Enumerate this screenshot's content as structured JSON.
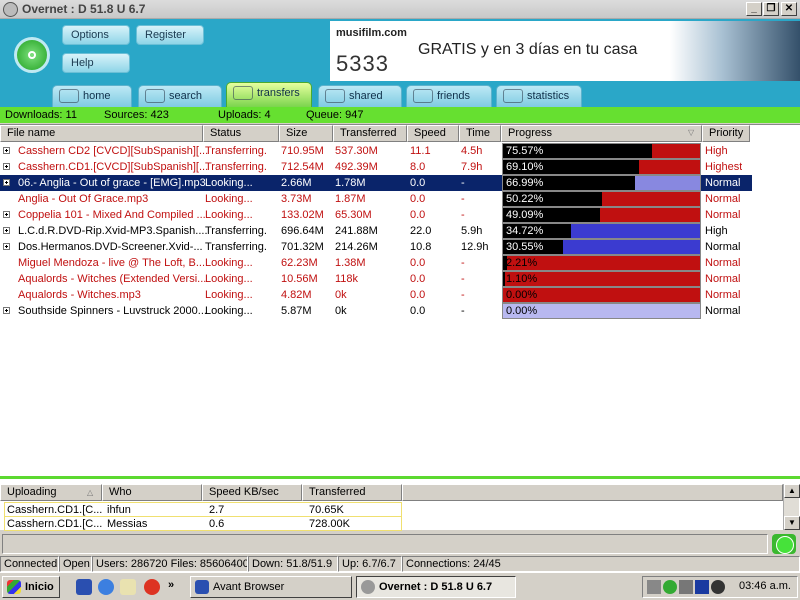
{
  "window": {
    "title": "Overnet : D 51.8 U 6.7"
  },
  "header": {
    "buttons": {
      "options": "Options",
      "register": "Register",
      "help": "Help"
    },
    "banner": {
      "brand": "musifilm.com",
      "number": "5333",
      "promo": "GRATIS y en 3 días en tu casa"
    },
    "tabs": [
      "home",
      "search",
      "transfers",
      "shared",
      "friends",
      "statistics"
    ],
    "active_tab": "transfers"
  },
  "summary": {
    "downloads": "Downloads: 11",
    "sources": "Sources: 423",
    "uploads": "Uploads: 4",
    "queue": "Queue: 947"
  },
  "columns": [
    "File name",
    "Status",
    "Size",
    "Transferred",
    "Speed",
    "Time",
    "Progress",
    "Priority"
  ],
  "rows": [
    {
      "name": "Casshern CD2 [CVCD][SubSpanish][...",
      "status": "Transferring.",
      "size": "710.95M",
      "transferred": "537.30M",
      "speed": "11.1",
      "time": "4.5h",
      "progress": "75.57%",
      "priority": "High",
      "expandable": true,
      "color": "red"
    },
    {
      "name": "Casshern.CD1.[CVCD][SubSpanish][...",
      "status": "Transferring.",
      "size": "712.54M",
      "transferred": "492.39M",
      "speed": "8.0",
      "time": "7.9h",
      "progress": "69.10%",
      "priority": "Highest",
      "expandable": true,
      "color": "red"
    },
    {
      "name": "06.- Anglia - Out of grace - [EMG].mp3",
      "status": "Looking...",
      "size": "2.66M",
      "transferred": "1.78M",
      "speed": "0.0",
      "time": "-",
      "progress": "66.99%",
      "priority": "Normal",
      "expandable": true,
      "color": "selected"
    },
    {
      "name": "Anglia - Out Of Grace.mp3",
      "status": "Looking...",
      "size": "3.73M",
      "transferred": "1.87M",
      "speed": "0.0",
      "time": "-",
      "progress": "50.22%",
      "priority": "Normal",
      "expandable": false,
      "color": "red"
    },
    {
      "name": "Coppelia 101 - Mixed And Compiled ...",
      "status": "Looking...",
      "size": "133.02M",
      "transferred": "65.30M",
      "speed": "0.0",
      "time": "-",
      "progress": "49.09%",
      "priority": "Normal",
      "expandable": true,
      "color": "red"
    },
    {
      "name": "L.C.d.R.DVD-Rip.Xvid-MP3.Spanish....",
      "status": "Transferring.",
      "size": "696.64M",
      "transferred": "241.88M",
      "speed": "22.0",
      "time": "5.9h",
      "progress": "34.72%",
      "priority": "High",
      "expandable": true,
      "color": "black"
    },
    {
      "name": "Dos.Hermanos.DVD-Screener.Xvid-...",
      "status": "Transferring.",
      "size": "701.32M",
      "transferred": "214.26M",
      "speed": "10.8",
      "time": "12.9h",
      "progress": "30.55%",
      "priority": "Normal",
      "expandable": true,
      "color": "black"
    },
    {
      "name": "Miguel Mendoza - live @ The Loft, B...",
      "status": "Looking...",
      "size": "62.23M",
      "transferred": "1.38M",
      "speed": "0.0",
      "time": "-",
      "progress": "2.21%",
      "priority": "Normal",
      "expandable": false,
      "color": "red"
    },
    {
      "name": "Aqualords - Witches (Extended Versi...",
      "status": "Looking...",
      "size": "10.56M",
      "transferred": "118k",
      "speed": "0.0",
      "time": "-",
      "progress": "1.10%",
      "priority": "Normal",
      "expandable": false,
      "color": "red"
    },
    {
      "name": "Aqualords - Witches.mp3",
      "status": "Looking...",
      "size": "4.82M",
      "transferred": "0k",
      "speed": "0.0",
      "time": "-",
      "progress": "0.00%",
      "priority": "Normal",
      "expandable": false,
      "color": "red"
    },
    {
      "name": "Southside Spinners - Luvstruck 2000...",
      "status": "Looking...",
      "size": "5.87M",
      "transferred": "0k",
      "speed": "0.0",
      "time": "-",
      "progress": "0.00%",
      "priority": "Normal",
      "expandable": true,
      "color": "black"
    }
  ],
  "progress_fill": [
    0.7557,
    0.691,
    0.6699,
    0.5022,
    0.4909,
    0.3472,
    0.3055,
    0.0221,
    0.011,
    0.0,
    0.0
  ],
  "progress_rest_color": [
    "#c01010",
    "#c01010",
    "#8888e0",
    "#c01010",
    "#c01010",
    "#3b3bd0",
    "#3b3bd0",
    "#c01010",
    "#c01010",
    "#c01010",
    "#b8b8f0"
  ],
  "uploads": {
    "columns": [
      "Uploading",
      "Who",
      "Speed KB/sec",
      "Transferred"
    ],
    "rows": [
      {
        "file": "Casshern.CD1.[C...",
        "who": "ihfun",
        "speed": "2.7",
        "transferred": "70.65K"
      },
      {
        "file": "Casshern.CD1.[C...",
        "who": "Messias",
        "speed": "0.6",
        "transferred": "728.00K"
      }
    ]
  },
  "statusbar": {
    "connected": "Connected",
    "open": "Open",
    "users_files": "Users: 286720 Files: 85606400",
    "down": "Down: 51.8/51.9",
    "up": "Up: 6.7/6.7",
    "connections": "Connections: 24/45"
  },
  "taskbar": {
    "start": "Inicio",
    "items": [
      "Avant Browser",
      "Overnet : D 51.8 U 6.7"
    ],
    "clock": "03:46 a.m."
  }
}
